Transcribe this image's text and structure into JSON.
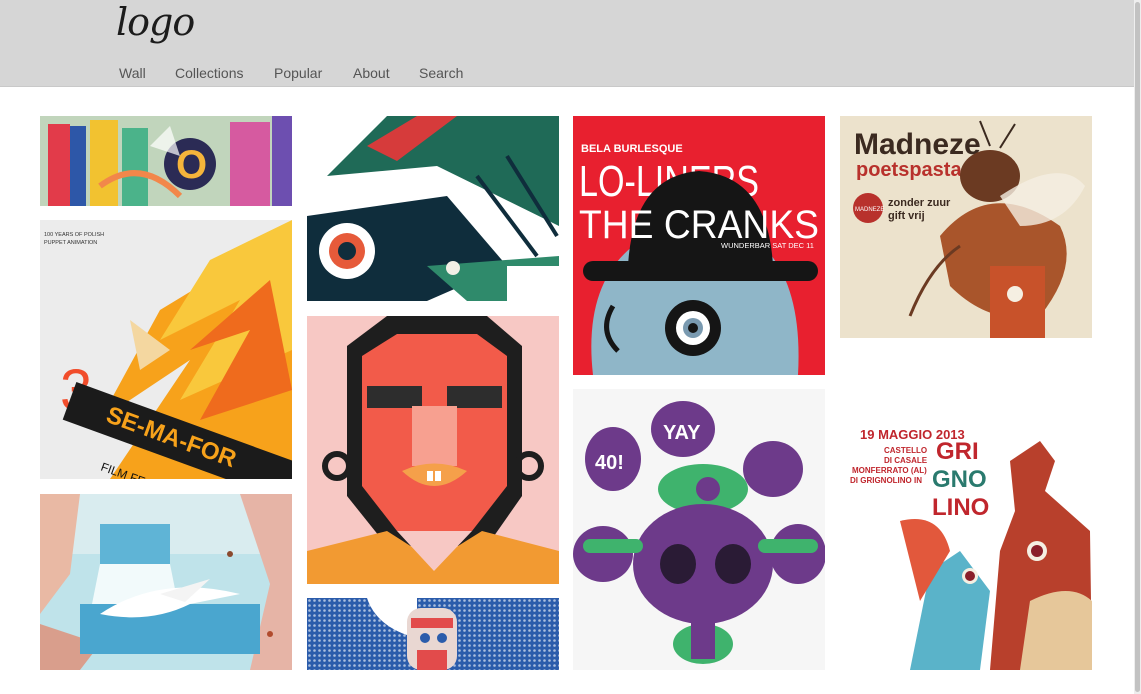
{
  "header": {
    "logo_text": "logo",
    "nav": [
      "Wall",
      "Collections",
      "Popular",
      "About",
      "Search"
    ]
  },
  "tiles": {
    "polish": {
      "top_small": "100 YEARS OF POLISH",
      "top_small2": "PUPPET ANIMATION",
      "number": "3.",
      "title": "SE-MA-FOR",
      "sub": "FILM FE"
    },
    "bela": {
      "small": "BELA BURLESQUE",
      "big1": "LO-LINERS",
      "big2": "THE CRANKS",
      "venue": "WUNDERBAR SAT DEC 11"
    },
    "madneze": {
      "title": "Madneze",
      "subtitle": "poetspasta",
      "line1": "zonder zuur",
      "line2": "gift vrij",
      "seal": "MADNEZE"
    },
    "grignolino": {
      "date": "19 MAGGIO 2013",
      "l1": "CASTELLO",
      "l2": "DI CASALE",
      "l3": "MONFERRATO (AL)",
      "l4": "DI GRIGNOLINO IN",
      "g1": "GRI",
      "g2": "GNO",
      "g3": "LINO"
    },
    "graffiti": {
      "t1": "40!",
      "t2": "YAY"
    }
  },
  "colors": {
    "header_bg": "#d6d6d6",
    "nav_text": "#555555",
    "bela_red": "#e8202f",
    "madneze_red": "#b8312c",
    "graffiti_purple": "#6d3a8a",
    "graffiti_green": "#3fb36d"
  }
}
